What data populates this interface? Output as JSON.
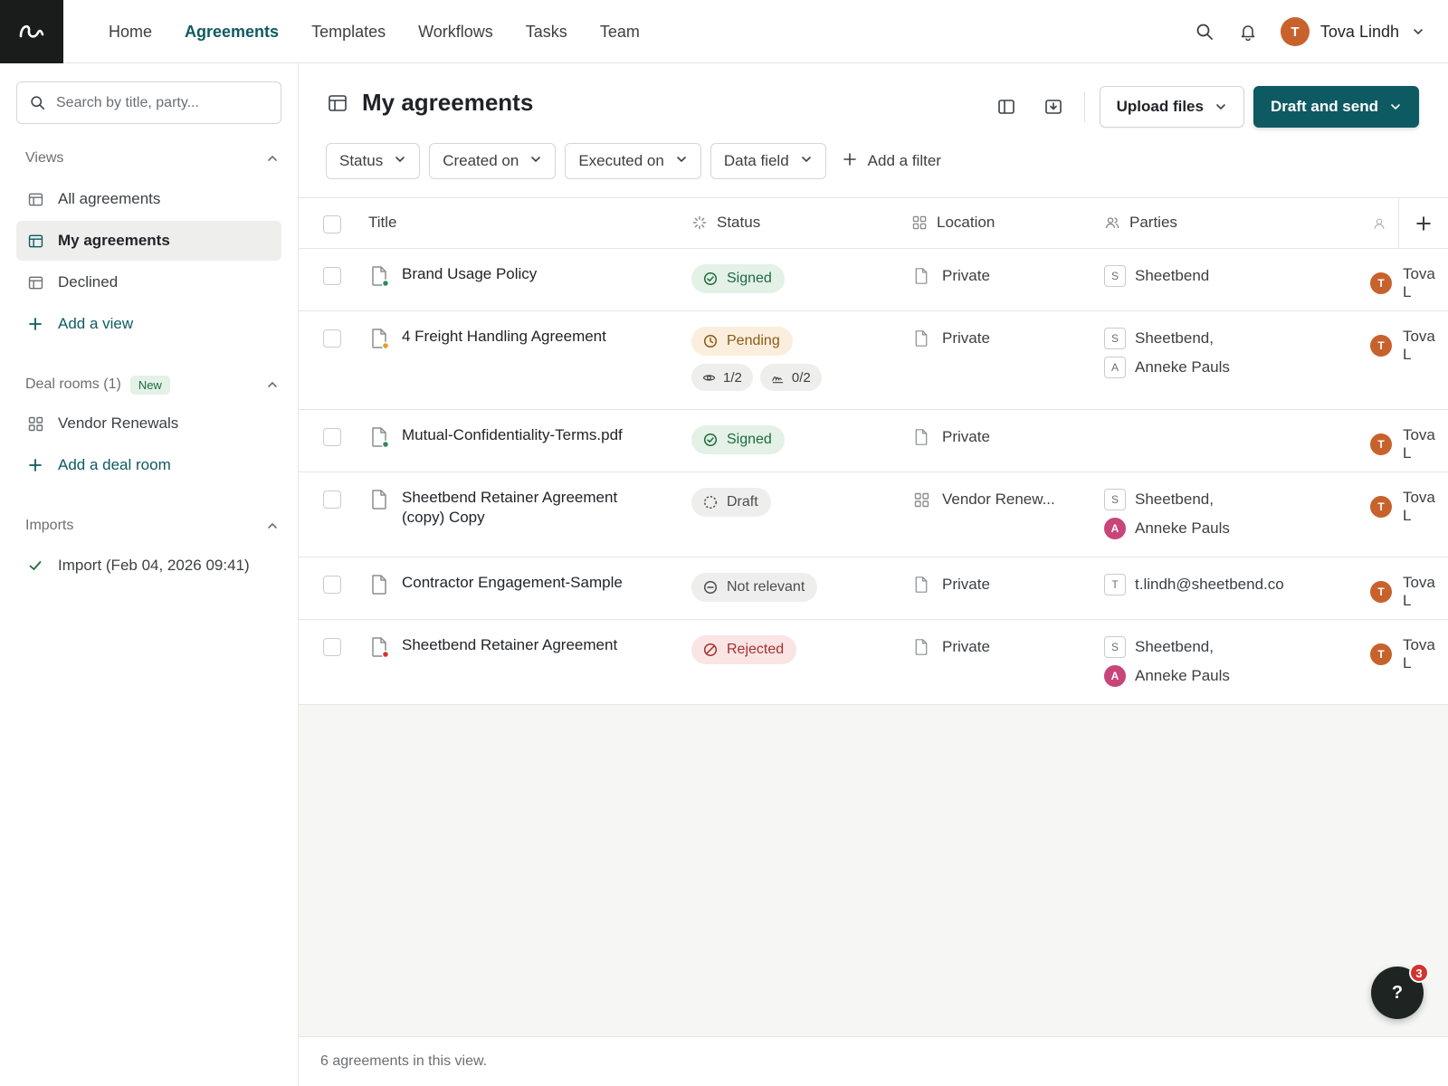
{
  "nav": {
    "items": [
      "Home",
      "Agreements",
      "Templates",
      "Workflows",
      "Tasks",
      "Team"
    ],
    "active": "Agreements"
  },
  "user": {
    "name": "Tova Lindh",
    "initial": "T",
    "avatar_color": "#c8622d"
  },
  "sidebar": {
    "search_placeholder": "Search by title, party...",
    "views_label": "Views",
    "views": [
      {
        "label": "All agreements",
        "active": false
      },
      {
        "label": "My agreements",
        "active": true
      },
      {
        "label": "Declined",
        "active": false
      }
    ],
    "add_view_label": "Add a view",
    "deal_rooms_label": "Deal rooms (1)",
    "new_badge": "New",
    "deal_rooms": [
      {
        "label": "Vendor Renewals"
      }
    ],
    "add_deal_room_label": "Add a deal room",
    "imports_label": "Imports",
    "imports": [
      {
        "label": "Import (Feb 04, 2026 09:41)"
      }
    ]
  },
  "main": {
    "title": "My agreements",
    "upload_label": "Upload files",
    "draft_label": "Draft and send",
    "filters": [
      "Status",
      "Created on",
      "Executed on",
      "Data field"
    ],
    "add_filter_label": "Add a filter",
    "columns": {
      "title": "Title",
      "status": "Status",
      "location": "Location",
      "parties": "Parties"
    },
    "rows": [
      {
        "title_lines": [
          "Brand Usage Policy"
        ],
        "doc_dot": "#2e8b57",
        "status": "Signed",
        "status_kind": "signed",
        "location": "Private",
        "parties": [
          {
            "initial": "S",
            "name": "Sheetbend",
            "round": false
          }
        ],
        "owner": "Tova L"
      },
      {
        "title_lines": [
          "4 Freight Handling Agreement"
        ],
        "doc_dot": "#e0a020",
        "status": "Pending",
        "status_kind": "pending",
        "viewed": "1/2",
        "signed": "0/2",
        "location": "Private",
        "parties": [
          {
            "initial": "S",
            "name": "Sheetbend,",
            "round": false
          },
          {
            "initial": "A",
            "name": "Anneke Pauls",
            "round": false
          }
        ],
        "owner": "Tova L"
      },
      {
        "title_lines": [
          "Mutual-Confidentiality-Terms.pdf"
        ],
        "doc_dot": "#2e8b57",
        "status": "Signed",
        "status_kind": "signed",
        "location": "Private",
        "parties": [],
        "owner": "Tova L"
      },
      {
        "title_lines": [
          "Sheetbend Retainer Agreement",
          "(copy) Copy"
        ],
        "doc_dot": null,
        "status": "Draft",
        "status_kind": "draft",
        "location": "Vendor Renew...",
        "location_kind": "dealroom",
        "parties": [
          {
            "initial": "S",
            "name": "Sheetbend,",
            "round": false
          },
          {
            "initial": "A",
            "name": "Anneke Pauls",
            "round": true
          }
        ],
        "owner": "Tova L"
      },
      {
        "title_lines": [
          "Contractor Engagement-Sample"
        ],
        "doc_dot": null,
        "status": "Not relevant",
        "status_kind": "notrel",
        "location": "Private",
        "parties": [
          {
            "initial": "T",
            "name": "t.lindh@sheetbend.co",
            "round": false
          }
        ],
        "owner": "Tova L"
      },
      {
        "title_lines": [
          "Sheetbend Retainer Agreement"
        ],
        "doc_dot": "#d2352f",
        "status": "Rejected",
        "status_kind": "rejected",
        "location": "Private",
        "parties": [
          {
            "initial": "S",
            "name": "Sheetbend,",
            "round": false
          },
          {
            "initial": "A",
            "name": "Anneke Pauls",
            "round": true
          }
        ],
        "owner": "Tova L"
      }
    ],
    "footer": "6 agreements in this view."
  },
  "help": {
    "label": "?",
    "count": "3"
  },
  "colors": {
    "accent": "#0e5a63",
    "owner_avatar": "#c8622d",
    "party_avatar": "#c8457a"
  }
}
